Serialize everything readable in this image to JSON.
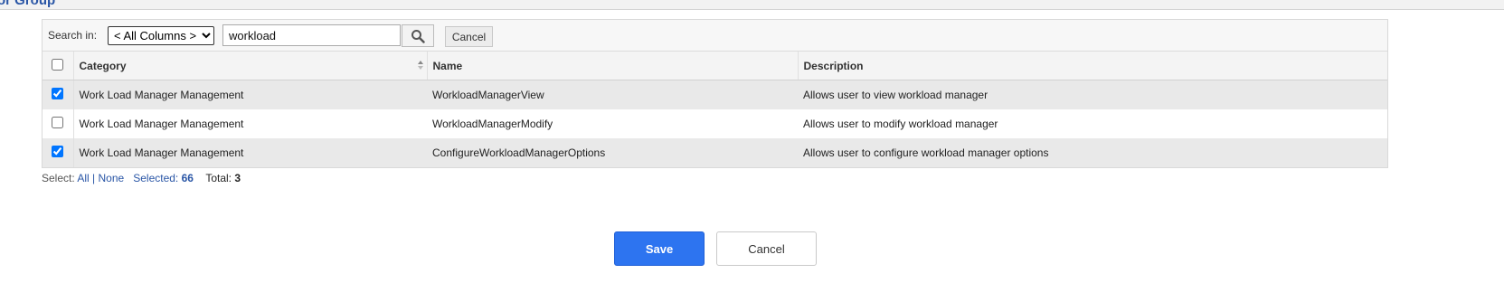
{
  "page": {
    "section_title": "for Group"
  },
  "search": {
    "label": "Search in:",
    "column_selected": "< All Columns >",
    "query": "workload",
    "cancel_label": "Cancel"
  },
  "table": {
    "columns": [
      "Category",
      "Name",
      "Description"
    ],
    "rows": [
      {
        "checked": true,
        "category": "Work Load Manager Management",
        "name": "WorkloadManagerView",
        "description": "Allows user to view workload manager"
      },
      {
        "checked": false,
        "category": "Work Load Manager Management",
        "name": "WorkloadManagerModify",
        "description": "Allows user to modify workload manager"
      },
      {
        "checked": true,
        "category": "Work Load Manager Management",
        "name": "ConfigureWorkloadManagerOptions",
        "description": "Allows user to configure workload manager options"
      }
    ]
  },
  "footer": {
    "select_label": "Select:",
    "all_label": "All",
    "separator": "|",
    "none_label": "None",
    "selected_label": "Selected:",
    "selected_count": "66",
    "total_label": "Total:",
    "total_count": "3"
  },
  "actions": {
    "save_label": "Save",
    "cancel_label": "Cancel"
  },
  "colors": {
    "accent": "#2d74f0",
    "link": "#2a56a6",
    "row_shade": "#e9e9e9"
  }
}
